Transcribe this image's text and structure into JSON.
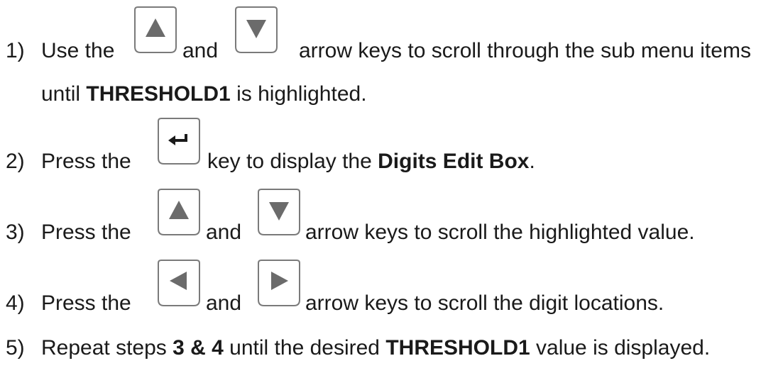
{
  "steps": [
    {
      "number": "1)",
      "line1": {
        "t1": "Use the",
        "t2": "and",
        "t3": "arrow keys to scroll through the sub menu items"
      },
      "line2": {
        "t1": "until ",
        "b1": "THRESHOLD1",
        "t2": " is highlighted."
      },
      "keys": [
        "up-arrow-key",
        "down-arrow-key"
      ]
    },
    {
      "number": "2)",
      "t1": "Press the",
      "t2": "key to display the ",
      "b1": "Digits Edit Box",
      "t3": ".",
      "keys": [
        "enter-key"
      ]
    },
    {
      "number": "3)",
      "t1": "Press the",
      "t2": "and",
      "t3": "arrow keys to scroll the highlighted value.",
      "keys": [
        "up-arrow-key",
        "down-arrow-key"
      ]
    },
    {
      "number": "4)",
      "t1": "Press the",
      "t2": "and",
      "t3": "arrow keys to scroll the digit locations.",
      "keys": [
        "left-arrow-key",
        "right-arrow-key"
      ]
    },
    {
      "number": "5)",
      "t1": "Repeat steps ",
      "b1": "3 & 4",
      "t2": " until the desired ",
      "b2": "THRESHOLD1",
      "t3": " value is displayed."
    }
  ],
  "colors": {
    "text": "#1a1a1a",
    "key_border": "#7a7a7a",
    "key_glyph": "#6b6b6b",
    "enter_glyph": "#1a1a1a"
  }
}
